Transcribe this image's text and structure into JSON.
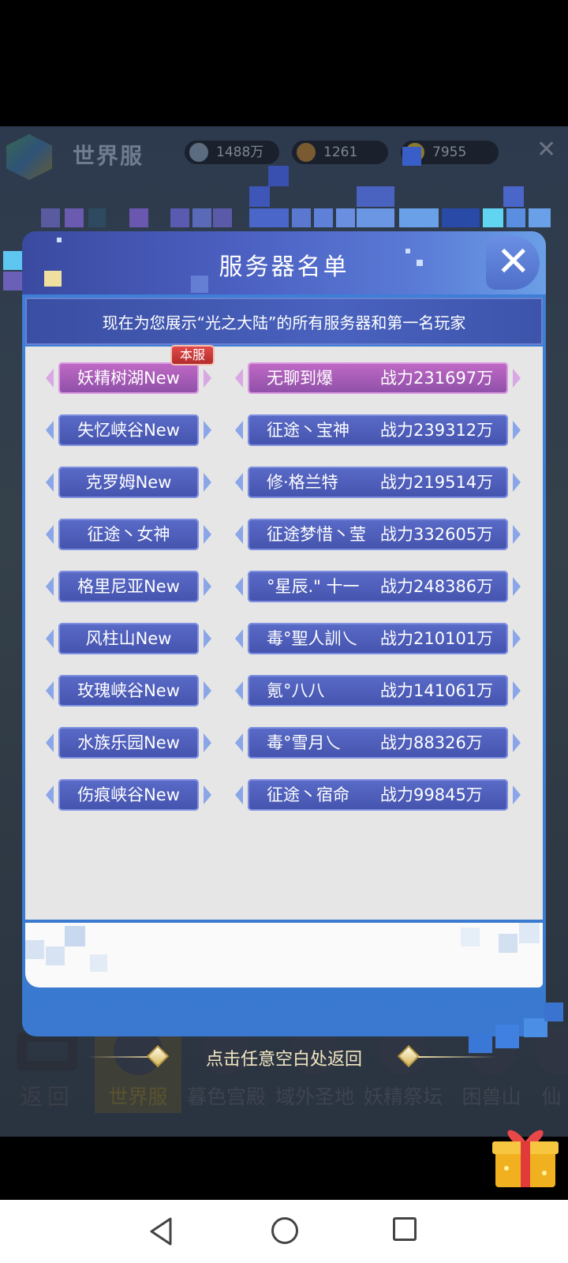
{
  "background": {
    "title": "世界服",
    "resources": [
      {
        "value": "1488万",
        "icon": "diamond-icon"
      },
      {
        "value": "1261",
        "icon": "crystal-icon"
      },
      {
        "value": "7955",
        "icon": "gold-coin-icon"
      }
    ],
    "bottom_nav": {
      "back_label": "返回",
      "tabs": [
        "世界服",
        "暮色宫殿",
        "域外圣地",
        "妖精祭坛",
        "困兽山",
        "仙"
      ]
    }
  },
  "modal": {
    "title": "服务器名单",
    "subtitle": "现在为您展示“光之大陆”的所有服务器和第一名玩家",
    "current_badge": "本服",
    "rows": [
      {
        "server": "妖精树湖New",
        "player": "无聊到爆",
        "power": "战力231697万"
      },
      {
        "server": "失忆峡谷New",
        "player": "征途丶宝神",
        "power": "战力239312万"
      },
      {
        "server": "克罗姆New",
        "player": "修·格兰特",
        "power": "战力219514万"
      },
      {
        "server": "征途丶女神",
        "player": "征途梦惜丶莹",
        "power": "战力332605万"
      },
      {
        "server": "格里尼亚New",
        "player": "°星辰.\" 十一",
        "power": "战力248386万"
      },
      {
        "server": "风柱山New",
        "player": "毒°聖人訓乀",
        "power": "战力210101万"
      },
      {
        "server": "玫瑰峡谷New",
        "player": "氪°八八",
        "power": "战力141061万"
      },
      {
        "server": "水族乐园New",
        "player": "毒°雪月乀",
        "power": "战力88326万"
      },
      {
        "server": "伤痕峡谷New",
        "player": "征途丶宿命",
        "power": "战力99845万"
      }
    ]
  },
  "return_hint": "点击任意空白处返回",
  "colors": {
    "modal_blue": "#3e7fd8",
    "row_button": "#4a59b5",
    "active_row_button": "#a85ab8",
    "badge_red": "#c93a3a"
  }
}
